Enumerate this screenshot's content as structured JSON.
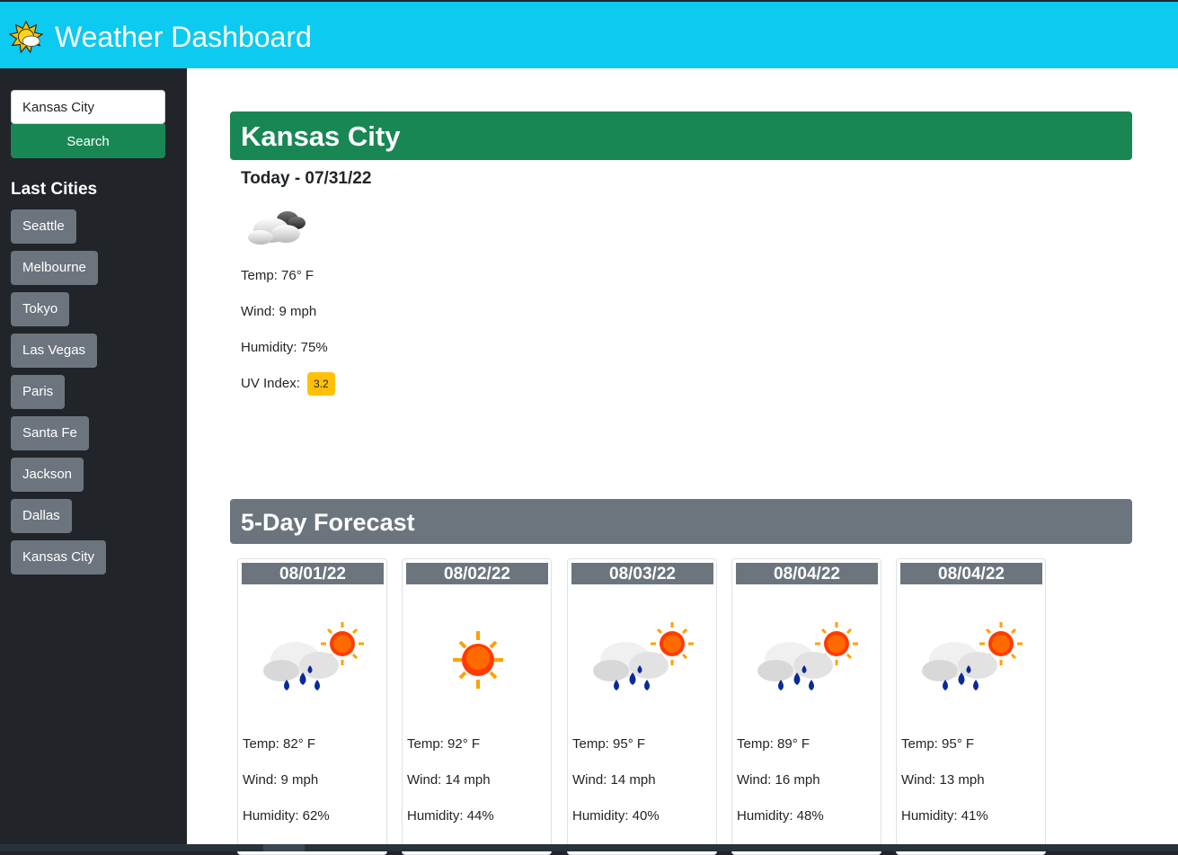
{
  "header": {
    "title": "Weather Dashboard",
    "icon": "sun-cloud-icon"
  },
  "sidebar": {
    "search_value": "Kansas City",
    "search_button": "Search",
    "last_cities_label": "Last Cities",
    "cities": [
      "Seattle",
      "Melbourne",
      "Tokyo",
      "Las Vegas",
      "Paris",
      "Santa Fe",
      "Jackson",
      "Dallas",
      "Kansas City"
    ]
  },
  "current": {
    "city": "Kansas City",
    "date_label": "Today - 07/31/22",
    "icon": "cloud-icon",
    "temp": "Temp: 76° F",
    "wind": "Wind: 9 mph",
    "humidity": "Humidity: 75%",
    "uv_label": "UV Index:",
    "uv_value": "3.2"
  },
  "forecast": {
    "title": "5-Day Forecast",
    "days": [
      {
        "date": "08/01/22",
        "icon": "rain-sun-icon",
        "temp": "Temp: 82° F",
        "wind": "Wind: 9 mph",
        "humidity": "Humidity: 62%"
      },
      {
        "date": "08/02/22",
        "icon": "sun-icon",
        "temp": "Temp: 92° F",
        "wind": "Wind: 14 mph",
        "humidity": "Humidity: 44%"
      },
      {
        "date": "08/03/22",
        "icon": "rain-sun-icon",
        "temp": "Temp: 95° F",
        "wind": "Wind: 14 mph",
        "humidity": "Humidity: 40%"
      },
      {
        "date": "08/04/22",
        "icon": "rain-sun-icon",
        "temp": "Temp: 89° F",
        "wind": "Wind: 16 mph",
        "humidity": "Humidity: 48%"
      },
      {
        "date": "08/04/22",
        "icon": "rain-sun-icon",
        "temp": "Temp: 95° F",
        "wind": "Wind: 13 mph",
        "humidity": "Humidity: 41%"
      }
    ]
  },
  "colors": {
    "header": "#0dcaf0",
    "success": "#198754",
    "secondary": "#6c757d",
    "warning": "#ffc107",
    "sidebar": "#212529"
  }
}
